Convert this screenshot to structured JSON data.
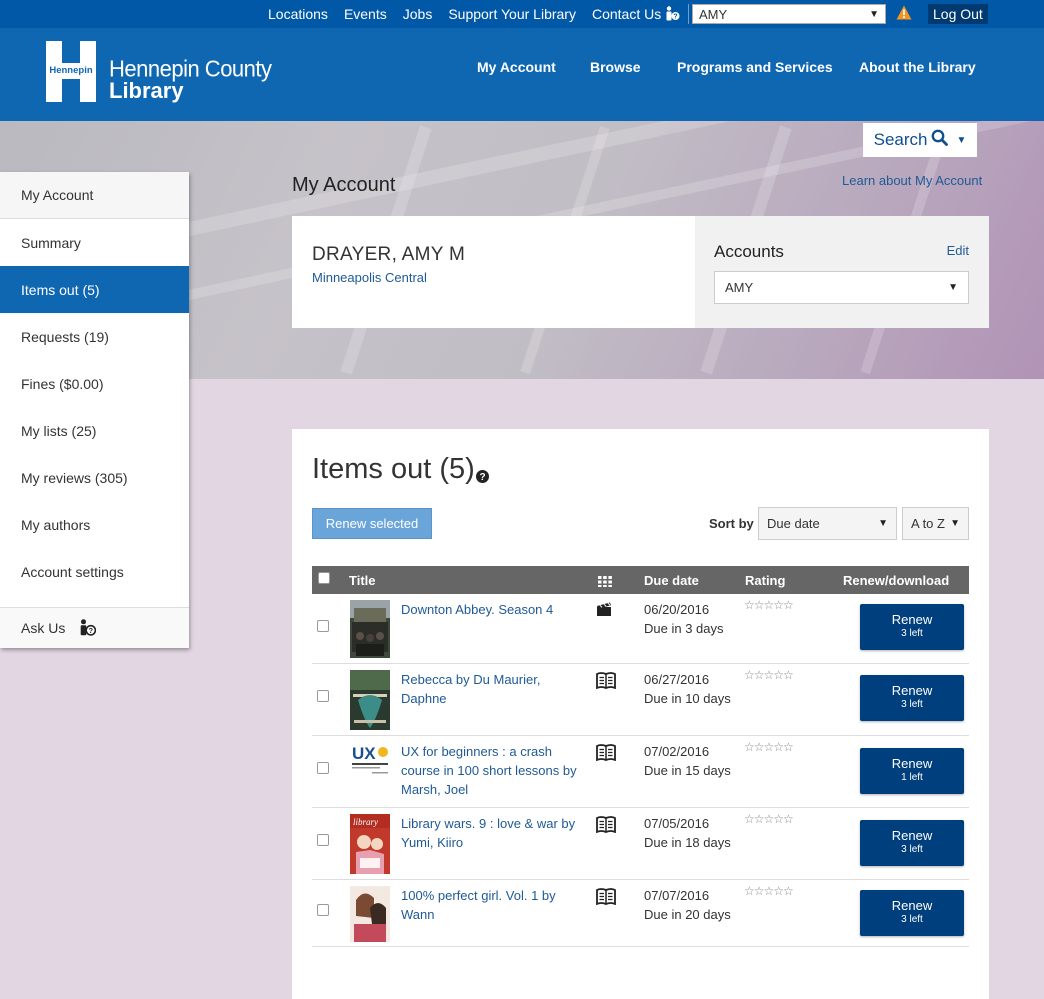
{
  "utility": {
    "links": [
      "Locations",
      "Events",
      "Jobs",
      "Support Your Library",
      "Contact Us"
    ],
    "account_select": "AMY",
    "logout": "Log Out"
  },
  "header": {
    "logo_text": "Hennepin",
    "brand_line1": "Hennepin County",
    "brand_line2": "Library",
    "nav": [
      "My Account",
      "Browse",
      "Programs and Services",
      "About the Library"
    ]
  },
  "hero": {
    "search_label": "Search",
    "page_title": "My Account",
    "learn_link": "Learn about My Account"
  },
  "patron": {
    "name": "DRAYER, AMY M",
    "branch": "Minneapolis Central"
  },
  "accounts": {
    "title": "Accounts",
    "edit": "Edit",
    "selected": "AMY"
  },
  "sidebar": {
    "items": [
      {
        "label": "My Account"
      },
      {
        "label": "Summary"
      },
      {
        "label": "Items out (5)"
      },
      {
        "label": "Requests (19)"
      },
      {
        "label": "Fines ($0.00)"
      },
      {
        "label": "My lists (25)"
      },
      {
        "label": "My reviews (305)"
      },
      {
        "label": "My authors"
      },
      {
        "label": "Account settings"
      },
      {
        "label": "Ask Us"
      }
    ],
    "active": "Items out (5)"
  },
  "items_out": {
    "heading": "Items out (5)",
    "renew_selected": "Renew selected",
    "sort_by_label": "Sort by",
    "sort_value": "Due date",
    "order_value": "A to Z",
    "columns": {
      "title": "Title",
      "due_date": "Due date",
      "rating": "Rating",
      "renew": "Renew/download"
    },
    "rows": [
      {
        "title": "Downton Abbey. Season 4",
        "format": "film-clapper-icon",
        "due_date": "06/20/2016",
        "due_in": "Due in 3 days",
        "renew": "Renew",
        "left": "3 left"
      },
      {
        "title": "Rebecca by Du Maurier, Daphne",
        "format": "book-icon",
        "due_date": "06/27/2016",
        "due_in": "Due in 10 days",
        "renew": "Renew",
        "left": "3 left"
      },
      {
        "title": "UX for beginners : a crash course in 100 short lessons by Marsh, Joel",
        "format": "book-icon",
        "due_date": "07/02/2016",
        "due_in": "Due in 15 days",
        "renew": "Renew",
        "left": "1 left"
      },
      {
        "title": "Library wars. 9 : love & war by Yumi, Kiiro",
        "format": "book-icon",
        "due_date": "07/05/2016",
        "due_in": "Due in 18 days",
        "renew": "Renew",
        "left": "3 left"
      },
      {
        "title": "100% perfect girl. Vol. 1 by Wann",
        "format": "book-icon",
        "due_date": "07/07/2016",
        "due_in": "Due in 20 days",
        "renew": "Renew",
        "left": "3 left"
      }
    ]
  },
  "colors": {
    "header_blue": "#0f67b1",
    "utility_blue": "#0058a6",
    "renew_button": "#003f7d",
    "link": "#1f5a96",
    "page_bg": "#e3d6e3"
  }
}
